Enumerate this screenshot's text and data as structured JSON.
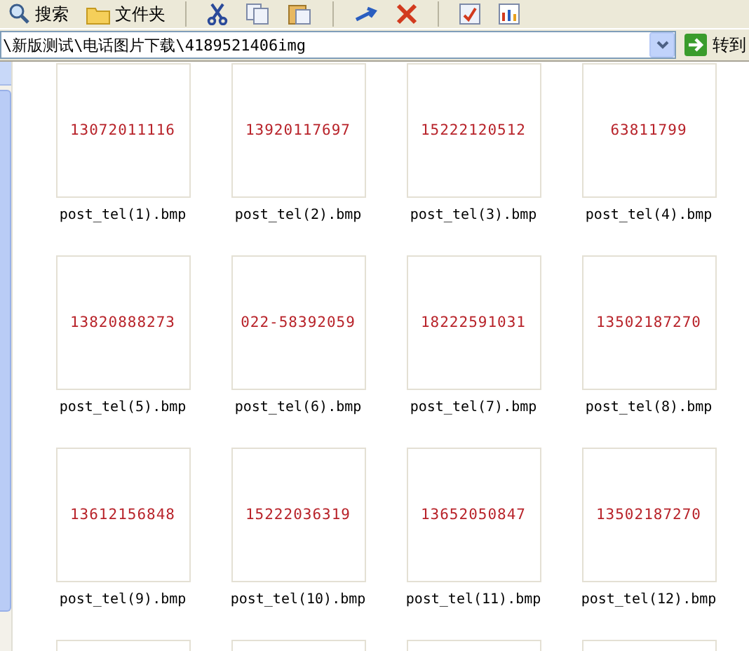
{
  "toolbar": {
    "buttons": [
      {
        "kind": "search",
        "label": "搜索"
      },
      {
        "kind": "folders",
        "label": "文件夹"
      },
      {
        "kind": "cut"
      },
      {
        "kind": "copy"
      },
      {
        "kind": "paste"
      },
      {
        "kind": "undo"
      },
      {
        "kind": "delete"
      },
      {
        "kind": "properties"
      },
      {
        "kind": "views"
      }
    ]
  },
  "address_bar": {
    "value": "\\新版测试\\电话图片下载\\4189521406img",
    "go_label": "转到"
  },
  "files": [
    {
      "kind": "file",
      "name": "post_tel(1).bmp",
      "thumbnail_text": "13072011116"
    },
    {
      "kind": "file",
      "name": "post_tel(2).bmp",
      "thumbnail_text": "13920117697"
    },
    {
      "kind": "file",
      "name": "post_tel(3).bmp",
      "thumbnail_text": "15222120512"
    },
    {
      "kind": "file",
      "name": "post_tel(4).bmp",
      "thumbnail_text": "63811799"
    },
    {
      "kind": "file",
      "name": "post_tel(5).bmp",
      "thumbnail_text": "13820888273"
    },
    {
      "kind": "file",
      "name": "post_tel(6).bmp",
      "thumbnail_text": "022-58392059"
    },
    {
      "kind": "file",
      "name": "post_tel(7).bmp",
      "thumbnail_text": "18222591031"
    },
    {
      "kind": "file",
      "name": "post_tel(8).bmp",
      "thumbnail_text": "13502187270"
    },
    {
      "kind": "file",
      "name": "post_tel(9).bmp",
      "thumbnail_text": "13612156848"
    },
    {
      "kind": "file",
      "name": "post_tel(10).bmp",
      "thumbnail_text": "15222036319"
    },
    {
      "kind": "file",
      "name": "post_tel(11).bmp",
      "thumbnail_text": "13652050847"
    },
    {
      "kind": "file",
      "name": "post_tel(12).bmp",
      "thumbnail_text": "13502187270"
    },
    {
      "kind": "partial"
    },
    {
      "kind": "partial"
    },
    {
      "kind": "partial"
    },
    {
      "kind": "partial"
    }
  ]
}
